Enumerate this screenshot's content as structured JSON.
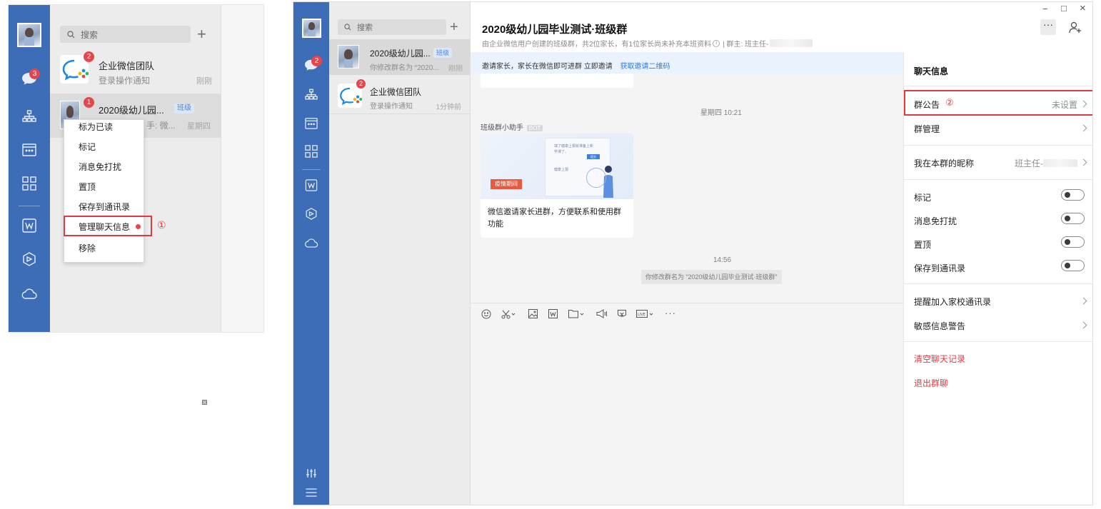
{
  "left_window": {
    "rail": {
      "chat_badge": "3"
    },
    "search": {
      "placeholder": "搜索"
    },
    "chats": [
      {
        "name": "企业微信团队",
        "preview": "登录操作通知",
        "time": "刚刚",
        "badge": "2"
      },
      {
        "name": "2020级幼儿园...",
        "tag": "班级",
        "preview": "手: 微...",
        "time": "星期四",
        "badge": "1"
      }
    ],
    "context_menu": {
      "items": [
        "标为已读",
        "标记",
        "消息免打扰",
        "置顶",
        "保存到通讯录",
        "管理聊天信息",
        "移除"
      ]
    },
    "annotation": "①"
  },
  "right_window": {
    "search": {
      "placeholder": "搜索"
    },
    "chats": [
      {
        "name": "2020级幼儿园...",
        "tag": "班级",
        "preview": "你修改群名为 “2020...",
        "time": "刚刚"
      },
      {
        "name": "企业微信团队",
        "preview": "登录操作通知",
        "time": "1分钟前",
        "badge": "2"
      }
    ],
    "rail": {
      "chat_badge": "2"
    },
    "header": {
      "title": "2020级幼儿园毕业测试·班级群",
      "subtitle": "由企业微信用户创建的班级群，共2位家长，有1位家长尚未补充本班资料",
      "owner": "| 群主: 班主任-"
    },
    "invite_bar": {
      "text": "邀请家长，家长在微信即可进群 立即邀请",
      "link": "获取邀请二维码"
    },
    "messages": {
      "time1": "星期四 10:21",
      "sender": "班级群小助手",
      "bot_tag": "BOT",
      "card_tag": "疫情期间",
      "card_text": "微信邀请家长进群，方便联系和使用群功能",
      "card_preview_line1": "填了健康上报就准备上新",
      "card_preview_line2": "学课了。",
      "card_preview_line3": "健康上报",
      "card_preview_button": "提交",
      "time2": "14:56",
      "system_msg": "你修改群名为 “2020级幼儿园毕业测试·班级群”"
    },
    "window_controls": {
      "min": "−",
      "max": "□",
      "close": "×"
    },
    "info_panel": {
      "title": "聊天信息",
      "announcement_label": "群公告",
      "announcement_anno": "②",
      "announcement_value": "未设置",
      "manage_label": "群管理",
      "nickname_label": "我在本群的昵称",
      "nickname_value": "班主任-",
      "toggles": [
        {
          "label": "标记",
          "on": false
        },
        {
          "label": "消息免打扰",
          "on": false
        },
        {
          "label": "置顶",
          "on": false
        },
        {
          "label": "保存到通讯录",
          "on": false
        }
      ],
      "remind_label": "提醒加入家校通讯录",
      "sensitive_label": "敏感信息警告",
      "clear_label": "清空聊天记录",
      "exit_label": "退出群聊"
    }
  },
  "colors": {
    "rail_blue": "#3e6db8",
    "badge_red": "#e5454b",
    "highlight_red": "#e3393e",
    "link_blue": "#2f7bd9"
  }
}
